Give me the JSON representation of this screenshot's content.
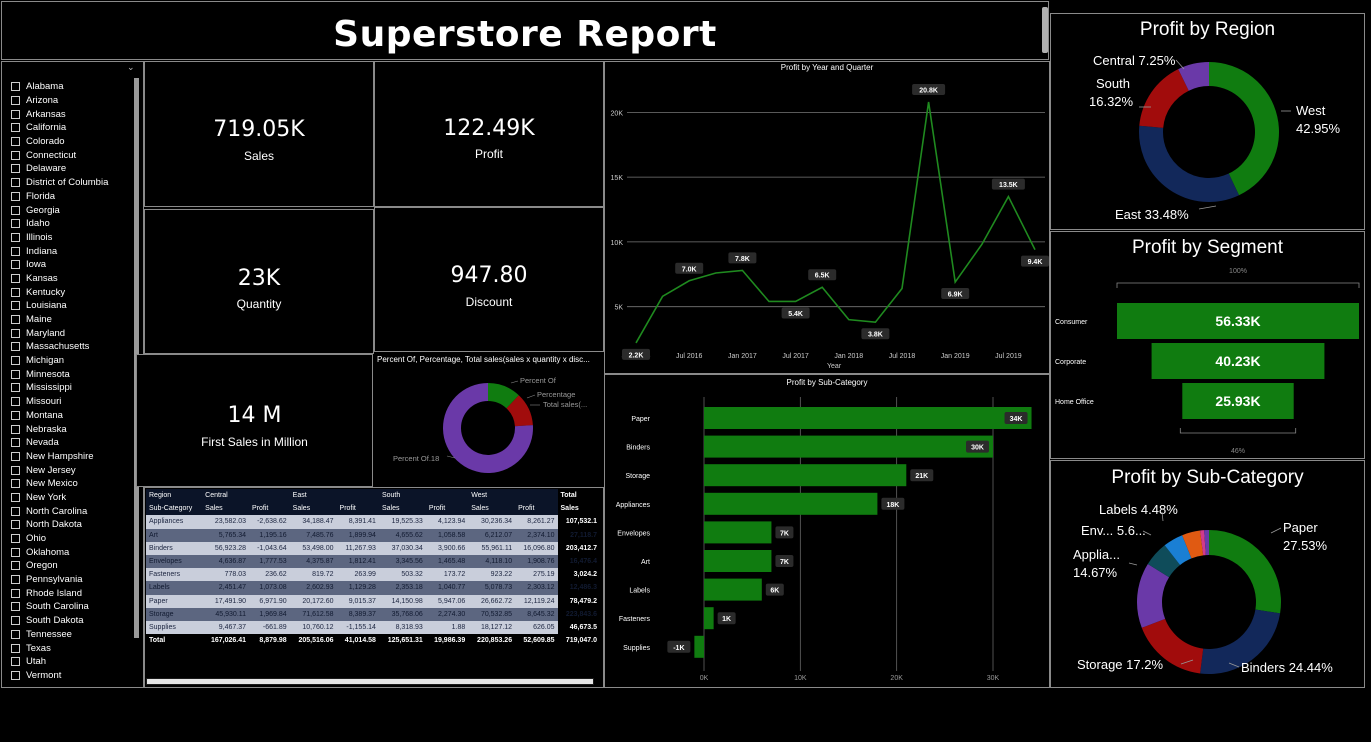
{
  "report_title": "Superstore Report",
  "states": [
    "Alabama",
    "Arizona",
    "Arkansas",
    "California",
    "Colorado",
    "Connecticut",
    "Delaware",
    "District of Columbia",
    "Florida",
    "Georgia",
    "Idaho",
    "Illinois",
    "Indiana",
    "Iowa",
    "Kansas",
    "Kentucky",
    "Louisiana",
    "Maine",
    "Maryland",
    "Massachusetts",
    "Michigan",
    "Minnesota",
    "Mississippi",
    "Missouri",
    "Montana",
    "Nebraska",
    "Nevada",
    "New Hampshire",
    "New Jersey",
    "New Mexico",
    "New York",
    "North Carolina",
    "North Dakota",
    "Ohio",
    "Oklahoma",
    "Oregon",
    "Pennsylvania",
    "Rhode Island",
    "South Carolina",
    "South Dakota",
    "Tennessee",
    "Texas",
    "Utah",
    "Vermont"
  ],
  "cards": {
    "sales": {
      "value": "719.05K",
      "label": "Sales"
    },
    "profit": {
      "value": "122.49K",
      "label": "Profit"
    },
    "quantity": {
      "value": "23K",
      "label": "Quantity"
    },
    "discount": {
      "value": "947.80",
      "label": "Discount"
    },
    "first_sales": {
      "value": "14 M",
      "label": "First Sales in Million"
    }
  },
  "colors": {
    "green": "#107c10",
    "navy": "#12285a",
    "red": "#a10c0c",
    "purple": "#6a39a8",
    "teal": "#0f4c5a",
    "blue": "#1a7fd4",
    "orange": "#e05a12",
    "pink": "#d13a8c"
  },
  "percent_donut": {
    "title": "Percent Of, Percentage, Total sales(sales x quantity x disc...",
    "labels": [
      "Percent Of",
      "Percentage",
      "Total sales(...",
      "Percent Of.18"
    ],
    "chart_data": {
      "type": "pie",
      "slices": [
        {
          "name": "Percent Of",
          "value": 0.12,
          "color": "#107c10"
        },
        {
          "name": "Percentage",
          "value": 0.12,
          "color": "#a10c0c"
        },
        {
          "name": "Percent Of.18",
          "value": 0.76,
          "color": "#6a39a8"
        }
      ]
    }
  },
  "matrix": {
    "region_label": "Region",
    "subcat_label": "Sub-Category",
    "regions": [
      "Central",
      "East",
      "South",
      "West"
    ],
    "total_label": "Total",
    "sales_label": "Sales",
    "profit_label": "Profit",
    "rows": [
      {
        "name": "Appliances",
        "cells": [
          "23,582.03",
          "-2,638.62",
          "34,188.47",
          "8,391.41",
          "19,525.33",
          "4,123.94",
          "30,236.34",
          "8,261.27"
        ],
        "total": "107,532.1"
      },
      {
        "name": "Art",
        "cells": [
          "5,765.34",
          "1,195.16",
          "7,485.76",
          "1,899.94",
          "4,655.62",
          "1,058.58",
          "6,212.07",
          "2,374.10"
        ],
        "total": "27,118.7"
      },
      {
        "name": "Binders",
        "cells": [
          "56,923.28",
          "-1,043.64",
          "53,498.00",
          "11,267.93",
          "37,030.34",
          "3,900.66",
          "55,961.11",
          "16,096.80"
        ],
        "total": "203,412.7"
      },
      {
        "name": "Envelopes",
        "cells": [
          "4,636.87",
          "1,777.53",
          "4,375.87",
          "1,812.41",
          "3,345.56",
          "1,465.48",
          "4,118.10",
          "1,908.76"
        ],
        "total": "16,476.4"
      },
      {
        "name": "Fasteners",
        "cells": [
          "778.03",
          "236.62",
          "819.72",
          "263.99",
          "503.32",
          "173.72",
          "923.22",
          "275.19"
        ],
        "total": "3,024.2"
      },
      {
        "name": "Labels",
        "cells": [
          "2,451.47",
          "1,073.08",
          "2,602.93",
          "1,129.28",
          "2,353.18",
          "1,040.77",
          "5,078.73",
          "2,303.12"
        ],
        "total": "12,486.3"
      },
      {
        "name": "Paper",
        "cells": [
          "17,491.90",
          "6,971.90",
          "20,172.60",
          "9,015.37",
          "14,150.98",
          "5,947.06",
          "26,662.72",
          "12,119.24"
        ],
        "total": "78,479.2"
      },
      {
        "name": "Storage",
        "cells": [
          "45,930.11",
          "1,969.84",
          "71,612.58",
          "8,389.37",
          "35,768.06",
          "2,274.30",
          "70,532.85",
          "8,645.32"
        ],
        "total": "223,843.6"
      },
      {
        "name": "Supplies",
        "cells": [
          "9,467.37",
          "-661.89",
          "10,760.12",
          "-1,155.14",
          "8,318.93",
          "1.88",
          "18,127.12",
          "626.05"
        ],
        "total": "46,673.5"
      }
    ],
    "total_row": {
      "name": "Total",
      "cells": [
        "167,026.41",
        "8,879.98",
        "205,516.06",
        "41,014.58",
        "125,651.31",
        "19,986.39",
        "220,853.26",
        "52,609.85"
      ],
      "total": "719,047.0"
    }
  },
  "line_chart": {
    "title": "Profit by Year and Quarter",
    "xlabel": "Year",
    "x_ticks": [
      "Jan 2016",
      "Jul 2016",
      "Jan 2017",
      "Jul 2017",
      "Jan 2018",
      "Jul 2018",
      "Jan 2019",
      "Jul 2019"
    ],
    "y_ticks": [
      "5K",
      "10K",
      "15K",
      "20K"
    ],
    "point_labels": [
      "2.2K",
      "7.0K",
      "7.8K",
      "5.4K",
      "6.5K",
      "3.8K",
      "20.8K",
      "6.9K",
      "13.5K",
      "9.4K"
    ],
    "chart_data": {
      "type": "line",
      "title": "Profit by Year and Quarter",
      "xlabel": "Year",
      "ylabel": "",
      "x": [
        "2016 Q1",
        "2016 Q2",
        "2016 Q3",
        "2016 Q4",
        "2017 Q1",
        "2017 Q2",
        "2017 Q3",
        "2017 Q4",
        "2018 Q1",
        "2018 Q2",
        "2018 Q3",
        "2018 Q4",
        "2019 Q1",
        "2019 Q2",
        "2019 Q3",
        "2019 Q4"
      ],
      "values": [
        2200,
        5800,
        7000,
        7600,
        7800,
        5400,
        5400,
        6500,
        4000,
        3800,
        6400,
        20800,
        6900,
        9800,
        13500,
        9400
      ],
      "labeled_points": [
        0,
        2,
        4,
        6,
        7,
        9,
        11,
        12,
        14,
        15
      ],
      "ylim": [
        1500,
        22500
      ],
      "grid": true
    }
  },
  "subcat_bar": {
    "title": "Profit by Sub-Category",
    "x_ticks": [
      "0K",
      "10K",
      "20K",
      "30K"
    ],
    "chart_data": {
      "type": "bar",
      "orientation": "horizontal",
      "title": "Profit by Sub-Category",
      "categories": [
        "Paper",
        "Binders",
        "Storage",
        "Appliances",
        "Envelopes",
        "Art",
        "Labels",
        "Fasteners",
        "Supplies"
      ],
      "values": [
        34000,
        30000,
        21000,
        18000,
        7000,
        7000,
        6000,
        1000,
        -1000
      ],
      "value_labels": [
        "34K",
        "30K",
        "21K",
        "18K",
        "7K",
        "7K",
        "6K",
        "1K",
        "-1K"
      ],
      "xlim": [
        -2000,
        34500
      ],
      "grid": true
    }
  },
  "region_donut": {
    "title": "Profit by Region",
    "labels": [
      "West 42.95%",
      "East 33.48%",
      "South 16.32%",
      "Central 7.25%"
    ],
    "chart_data": {
      "type": "pie",
      "slices": [
        {
          "name": "West",
          "value": 42.95,
          "color": "#107c10"
        },
        {
          "name": "East",
          "value": 33.48,
          "color": "#12285a"
        },
        {
          "name": "South",
          "value": 16.32,
          "color": "#a10c0c"
        },
        {
          "name": "Central",
          "value": 7.25,
          "color": "#6a39a8"
        }
      ]
    }
  },
  "segment_funnel": {
    "title": "Profit by Segment",
    "top_pct": "100%",
    "bottom_pct": "46%",
    "chart_data": {
      "type": "bar",
      "subtype": "funnel",
      "categories": [
        "Consumer",
        "Corporate",
        "Home Office"
      ],
      "values": [
        56330,
        40230,
        25930
      ],
      "value_labels": [
        "56.33K",
        "40.23K",
        "25.93K"
      ]
    }
  },
  "subcat_donut": {
    "title": "Profit by Sub-Category",
    "labels": [
      "Paper 27.53%",
      "Binders 24.44%",
      "Storage 17.2%",
      "Appliances 14.67%",
      "Env... 5.6...",
      "Labels 4.48%"
    ],
    "label_parts": {
      "paper": [
        "Paper",
        "27.53%"
      ],
      "binders": "Binders 24.44%",
      "storage": "Storage 17.2%",
      "appliances": [
        "Applia...",
        "14.67%"
      ],
      "envelopes": "Env... 5.6...",
      "labels": "Labels 4.48%"
    },
    "chart_data": {
      "type": "pie",
      "slices": [
        {
          "name": "Paper",
          "value": 27.53,
          "color": "#107c10"
        },
        {
          "name": "Binders",
          "value": 24.44,
          "color": "#12285a"
        },
        {
          "name": "Storage",
          "value": 17.2,
          "color": "#a10c0c"
        },
        {
          "name": "Appliances",
          "value": 14.67,
          "color": "#6a39a8"
        },
        {
          "name": "Envelopes",
          "value": 5.6,
          "color": "#0f4c5a"
        },
        {
          "name": "Labels",
          "value": 4.48,
          "color": "#1a7fd4"
        },
        {
          "name": "Art",
          "value": 4.1,
          "color": "#e05a12"
        },
        {
          "name": "Fasteners",
          "value": 0.9,
          "color": "#d13a8c"
        },
        {
          "name": "Supplies",
          "value": 1.08,
          "color": "#6a39a8"
        }
      ]
    }
  }
}
